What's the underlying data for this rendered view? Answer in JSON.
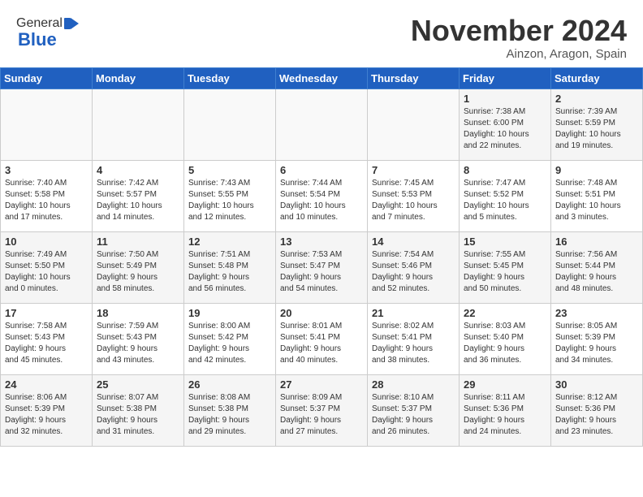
{
  "header": {
    "logo_general": "General",
    "logo_blue": "Blue",
    "month": "November 2024",
    "location": "Ainzon, Aragon, Spain"
  },
  "days_of_week": [
    "Sunday",
    "Monday",
    "Tuesday",
    "Wednesday",
    "Thursday",
    "Friday",
    "Saturday"
  ],
  "weeks": [
    [
      {
        "day": "",
        "info": ""
      },
      {
        "day": "",
        "info": ""
      },
      {
        "day": "",
        "info": ""
      },
      {
        "day": "",
        "info": ""
      },
      {
        "day": "",
        "info": ""
      },
      {
        "day": "1",
        "info": "Sunrise: 7:38 AM\nSunset: 6:00 PM\nDaylight: 10 hours\nand 22 minutes."
      },
      {
        "day": "2",
        "info": "Sunrise: 7:39 AM\nSunset: 5:59 PM\nDaylight: 10 hours\nand 19 minutes."
      }
    ],
    [
      {
        "day": "3",
        "info": "Sunrise: 7:40 AM\nSunset: 5:58 PM\nDaylight: 10 hours\nand 17 minutes."
      },
      {
        "day": "4",
        "info": "Sunrise: 7:42 AM\nSunset: 5:57 PM\nDaylight: 10 hours\nand 14 minutes."
      },
      {
        "day": "5",
        "info": "Sunrise: 7:43 AM\nSunset: 5:55 PM\nDaylight: 10 hours\nand 12 minutes."
      },
      {
        "day": "6",
        "info": "Sunrise: 7:44 AM\nSunset: 5:54 PM\nDaylight: 10 hours\nand 10 minutes."
      },
      {
        "day": "7",
        "info": "Sunrise: 7:45 AM\nSunset: 5:53 PM\nDaylight: 10 hours\nand 7 minutes."
      },
      {
        "day": "8",
        "info": "Sunrise: 7:47 AM\nSunset: 5:52 PM\nDaylight: 10 hours\nand 5 minutes."
      },
      {
        "day": "9",
        "info": "Sunrise: 7:48 AM\nSunset: 5:51 PM\nDaylight: 10 hours\nand 3 minutes."
      }
    ],
    [
      {
        "day": "10",
        "info": "Sunrise: 7:49 AM\nSunset: 5:50 PM\nDaylight: 10 hours\nand 0 minutes."
      },
      {
        "day": "11",
        "info": "Sunrise: 7:50 AM\nSunset: 5:49 PM\nDaylight: 9 hours\nand 58 minutes."
      },
      {
        "day": "12",
        "info": "Sunrise: 7:51 AM\nSunset: 5:48 PM\nDaylight: 9 hours\nand 56 minutes."
      },
      {
        "day": "13",
        "info": "Sunrise: 7:53 AM\nSunset: 5:47 PM\nDaylight: 9 hours\nand 54 minutes."
      },
      {
        "day": "14",
        "info": "Sunrise: 7:54 AM\nSunset: 5:46 PM\nDaylight: 9 hours\nand 52 minutes."
      },
      {
        "day": "15",
        "info": "Sunrise: 7:55 AM\nSunset: 5:45 PM\nDaylight: 9 hours\nand 50 minutes."
      },
      {
        "day": "16",
        "info": "Sunrise: 7:56 AM\nSunset: 5:44 PM\nDaylight: 9 hours\nand 48 minutes."
      }
    ],
    [
      {
        "day": "17",
        "info": "Sunrise: 7:58 AM\nSunset: 5:43 PM\nDaylight: 9 hours\nand 45 minutes."
      },
      {
        "day": "18",
        "info": "Sunrise: 7:59 AM\nSunset: 5:43 PM\nDaylight: 9 hours\nand 43 minutes."
      },
      {
        "day": "19",
        "info": "Sunrise: 8:00 AM\nSunset: 5:42 PM\nDaylight: 9 hours\nand 42 minutes."
      },
      {
        "day": "20",
        "info": "Sunrise: 8:01 AM\nSunset: 5:41 PM\nDaylight: 9 hours\nand 40 minutes."
      },
      {
        "day": "21",
        "info": "Sunrise: 8:02 AM\nSunset: 5:41 PM\nDaylight: 9 hours\nand 38 minutes."
      },
      {
        "day": "22",
        "info": "Sunrise: 8:03 AM\nSunset: 5:40 PM\nDaylight: 9 hours\nand 36 minutes."
      },
      {
        "day": "23",
        "info": "Sunrise: 8:05 AM\nSunset: 5:39 PM\nDaylight: 9 hours\nand 34 minutes."
      }
    ],
    [
      {
        "day": "24",
        "info": "Sunrise: 8:06 AM\nSunset: 5:39 PM\nDaylight: 9 hours\nand 32 minutes."
      },
      {
        "day": "25",
        "info": "Sunrise: 8:07 AM\nSunset: 5:38 PM\nDaylight: 9 hours\nand 31 minutes."
      },
      {
        "day": "26",
        "info": "Sunrise: 8:08 AM\nSunset: 5:38 PM\nDaylight: 9 hours\nand 29 minutes."
      },
      {
        "day": "27",
        "info": "Sunrise: 8:09 AM\nSunset: 5:37 PM\nDaylight: 9 hours\nand 27 minutes."
      },
      {
        "day": "28",
        "info": "Sunrise: 8:10 AM\nSunset: 5:37 PM\nDaylight: 9 hours\nand 26 minutes."
      },
      {
        "day": "29",
        "info": "Sunrise: 8:11 AM\nSunset: 5:36 PM\nDaylight: 9 hours\nand 24 minutes."
      },
      {
        "day": "30",
        "info": "Sunrise: 8:12 AM\nSunset: 5:36 PM\nDaylight: 9 hours\nand 23 minutes."
      }
    ]
  ]
}
